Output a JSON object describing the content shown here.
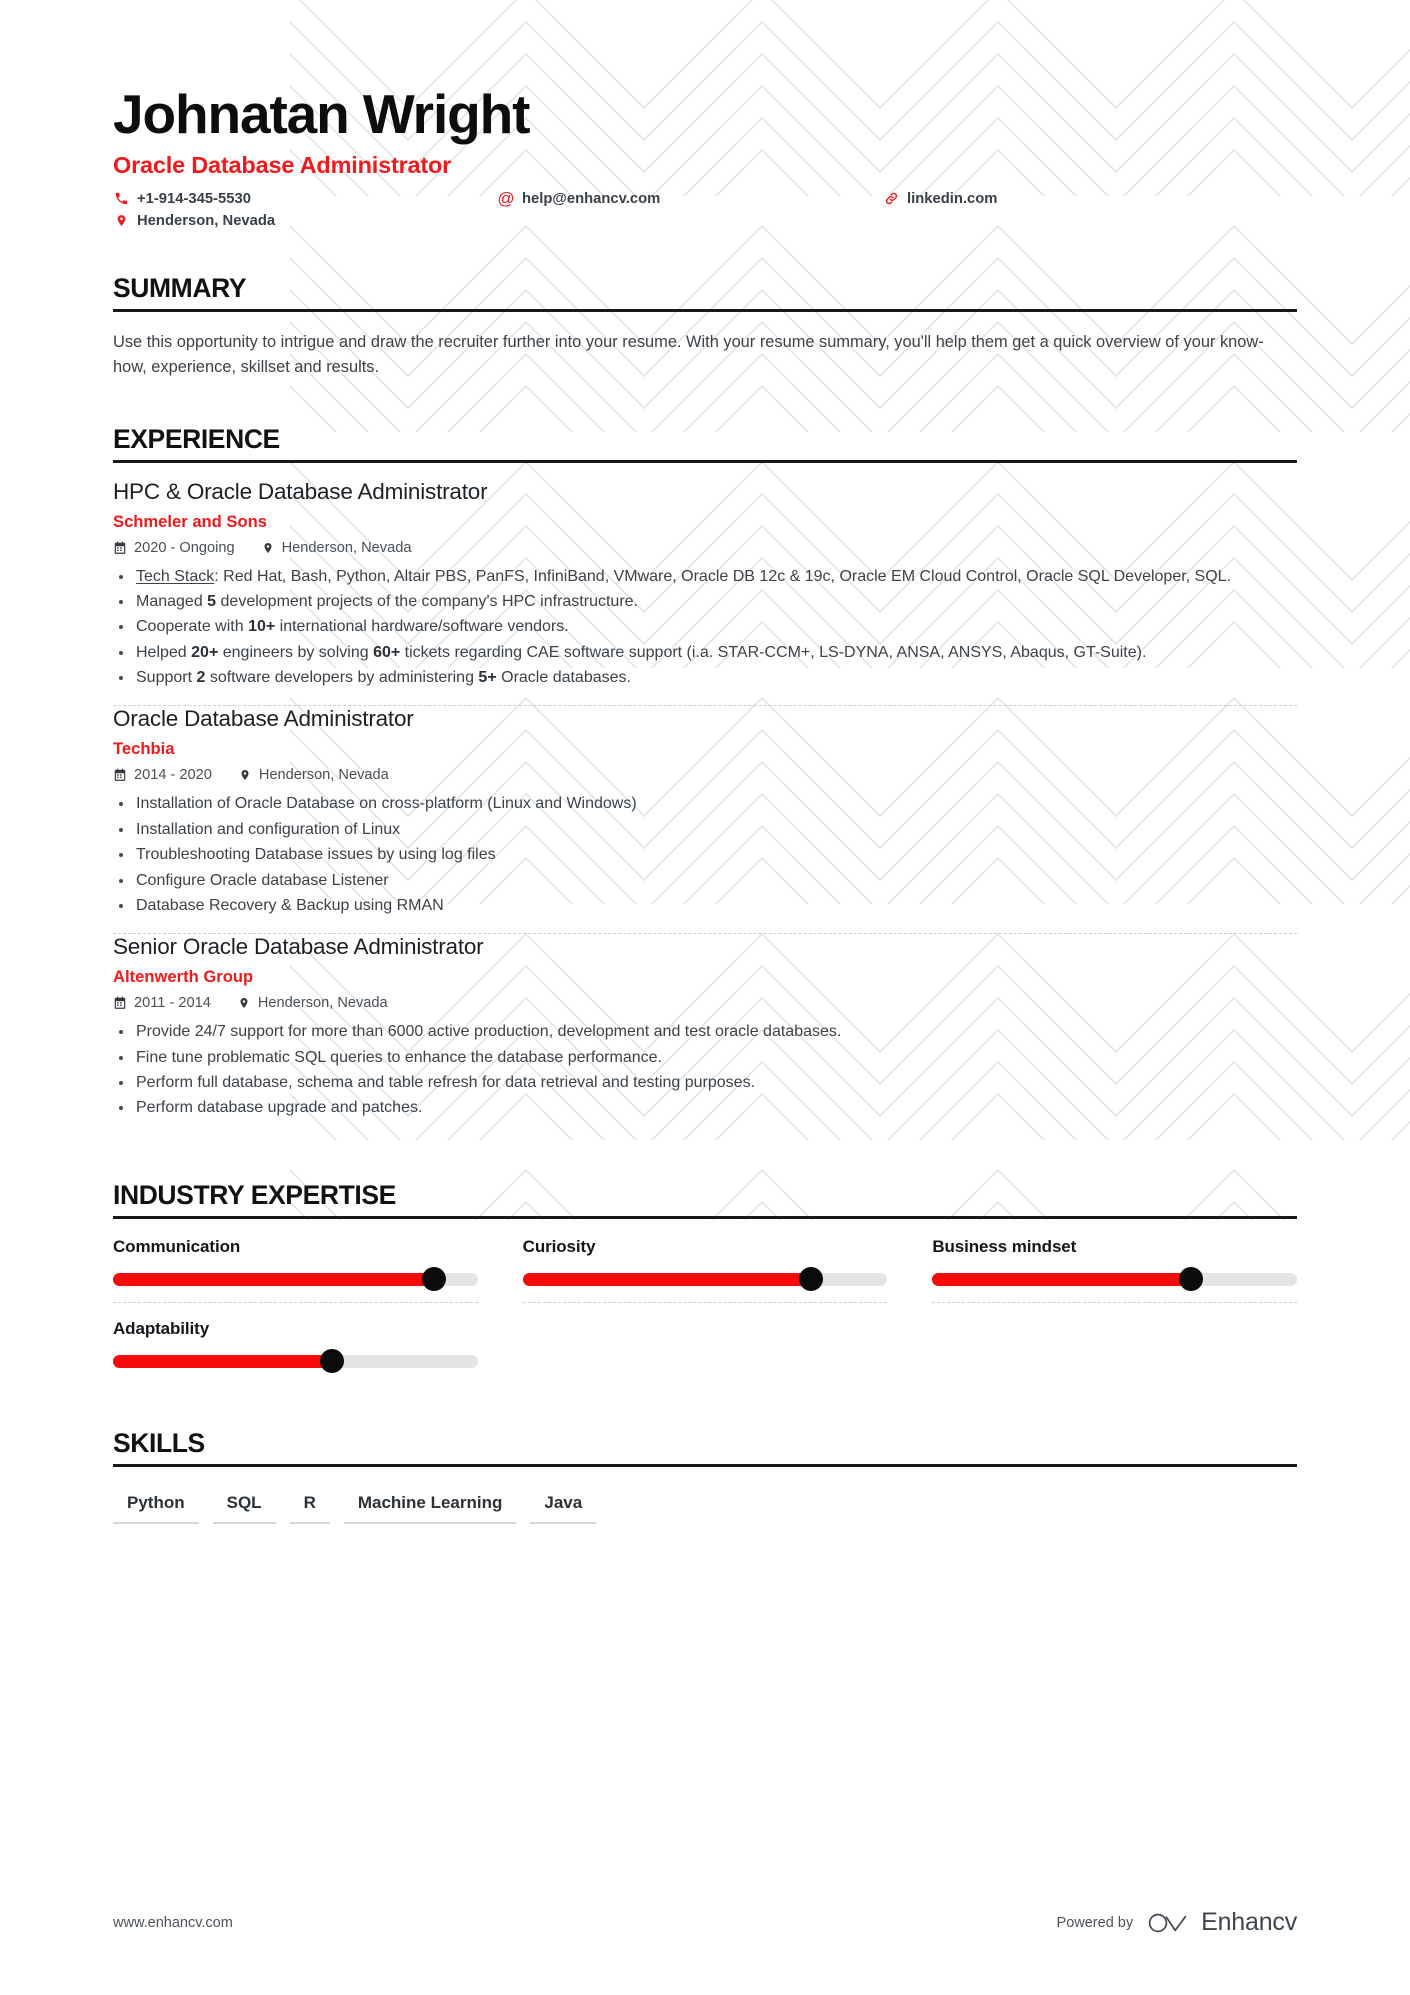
{
  "theme": {
    "accent": "#f0191b",
    "slider_fill": "#f60b0b",
    "knob": "#0b0b0b",
    "track": "#e3e5e5",
    "text": "#3c4248",
    "heading": "#101214"
  },
  "header": {
    "name": "Johnatan Wright",
    "job_title": "Oracle Database Administrator",
    "contacts": [
      {
        "icon": "phone-icon",
        "value": "+1-914-345-5530"
      },
      {
        "icon": "email-icon",
        "value": "help@enhancv.com"
      },
      {
        "icon": "link-icon",
        "value": "linkedin.com"
      },
      {
        "icon": "location-icon",
        "value": "Henderson, Nevada"
      }
    ]
  },
  "summary": {
    "title": "SUMMARY",
    "text": "Use this opportunity to intrigue and draw the recruiter further into your resume. With your resume summary, you'll help them get a quick overview of your know-how, experience, skillset and results."
  },
  "experience": {
    "title": "EXPERIENCE",
    "entries": [
      {
        "role": "HPC & Oracle Database Administrator",
        "company": "Schmeler and Sons",
        "dates": "2020 - Ongoing",
        "location": "Henderson, Nevada",
        "bullets": [
          "<u>Tech Stack</u>: Red Hat, Bash, Python, Altair PBS, PanFS, InfiniBand, VMware, Oracle DB 12c &amp; 19c, Oracle EM Cloud Control, Oracle SQL Developer, SQL.",
          "Managed <b>5</b> development projects of the company's HPC infrastructure.",
          "Cooperate with <b>10+</b> international hardware/software vendors.",
          "Helped <b>20+</b> engineers by solving <b>60+</b> tickets regarding CAE software support (i.a. STAR-CCM+, LS-DYNA, ANSA, ANSYS, Abaqus, GT-Suite).",
          "Support <b>2</b> software developers by administering <b>5+</b> Oracle databases."
        ]
      },
      {
        "role": "Oracle Database Administrator",
        "company": "Techbia",
        "dates": "2014 - 2020",
        "location": "Henderson, Nevada",
        "bullets": [
          "Installation of Oracle Database on cross-platform (Linux and Windows)",
          "Installation and configuration of Linux",
          "Troubleshooting Database issues by using log files",
          "Configure Oracle database Listener",
          "Database Recovery &amp; Backup using RMAN"
        ]
      },
      {
        "role": "Senior Oracle Database Administrator",
        "company": "Altenwerth Group",
        "dates": "2011 - 2014",
        "location": "Henderson, Nevada",
        "bullets": [
          "Provide 24/7 support for more than 6000 active production, development and test oracle databases.",
          "Fine tune problematic SQL queries to enhance the database performance.",
          "Perform full database, schema and table refresh for data retrieval and testing purposes.",
          "Perform database upgrade and patches."
        ]
      }
    ]
  },
  "industry_expertise": {
    "title": "INDUSTRY EXPERTISE",
    "items": [
      {
        "label": "Communication",
        "value": 88
      },
      {
        "label": "Curiosity",
        "value": 79
      },
      {
        "label": "Business mindset",
        "value": 71
      },
      {
        "label": "Adaptability",
        "value": 60
      }
    ]
  },
  "skills": {
    "title": "SKILLS",
    "items": [
      "Python",
      "SQL",
      "R",
      "Machine Learning",
      "Java"
    ]
  },
  "footer": {
    "url": "www.enhancv.com",
    "powered_by": "Powered by",
    "brand": "Enhancv"
  }
}
